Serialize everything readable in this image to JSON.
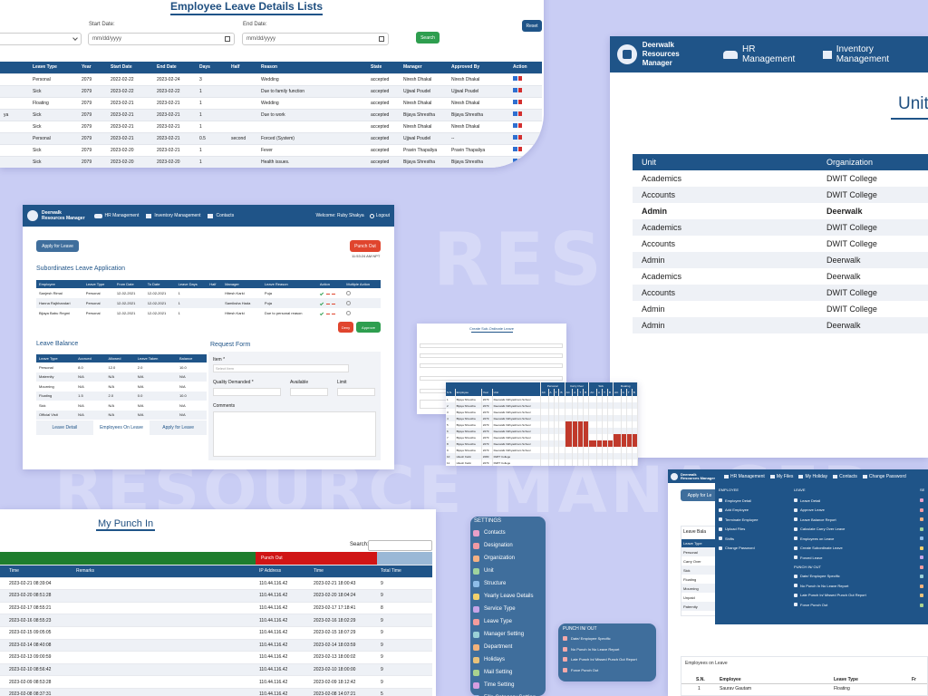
{
  "background_watermarks": [
    "RESOURCE MANAGER",
    "RESOURCE MANAGER"
  ],
  "leave_details": {
    "title": "Employee Leave Details Lists",
    "start_date_label": "Start Date:",
    "start_date_placeholder": "mm/dd/yyyy",
    "end_date_label": "End Date:",
    "end_date_placeholder": "mm/dd/yyyy",
    "search_label": "Search",
    "reset_label": "Reset",
    "columns": [
      "Leave Type",
      "Year",
      "Start Date",
      "End Date",
      "Days",
      "Half",
      "Reason",
      "State",
      "Manager",
      "Approved By",
      "Action"
    ],
    "rows": [
      [
        "Personal",
        "2079",
        "2022-02-22",
        "2023-02-24",
        "3",
        "",
        "Wedding",
        "accepted",
        "Niresh Dhakal",
        "Niresh Dhakal"
      ],
      [
        "Sick",
        "2079",
        "2023-02-22",
        "2023-02-22",
        "1",
        "",
        "Due to family function",
        "accepted",
        "Ujjwal Poudel",
        "Ujjwal Poudel"
      ],
      [
        "Floating",
        "2079",
        "2023-02-21",
        "2023-02-21",
        "1",
        "",
        "Wedding",
        "accepted",
        "Niresh Dhakal",
        "Niresh Dhakal"
      ],
      [
        "Sick",
        "2079",
        "2023-02-21",
        "2023-02-21",
        "1",
        "",
        "Due to work",
        "accepted",
        "Bijaya Shrestha",
        "Bijaya Shrestha"
      ],
      [
        "Sick",
        "2079",
        "2023-02-21",
        "2023-02-21",
        "1",
        "",
        "",
        "accepted",
        "Niresh Dhakal",
        "Niresh Dhakal"
      ],
      [
        "Personal",
        "2079",
        "2023-02-21",
        "2023-02-21",
        "0.5",
        "second",
        "Forced (System)",
        "accepted",
        "Ujjwal Poudel",
        "--"
      ],
      [
        "Sick",
        "2079",
        "2023-02-20",
        "2023-02-21",
        "1",
        "",
        "Fever",
        "accepted",
        "Pravin Thapaliya",
        "Pravin Thapaliya"
      ],
      [
        "Sick",
        "2079",
        "2023-02-20",
        "2023-02-20",
        "1",
        "",
        "Health issues.",
        "accepted",
        "Bijaya Shrestha",
        "Bijaya Shrestha"
      ]
    ],
    "partial_first_column": [
      "",
      "",
      "",
      "ya",
      "",
      "",
      "",
      ""
    ]
  },
  "unit_page": {
    "brand_line1": "Deerwalk",
    "brand_line2": "Resources Manager",
    "nav_hr": "HR Management",
    "nav_inventory": "Inventory Management",
    "title_partial": "Unit",
    "columns": [
      "Unit",
      "Organization"
    ],
    "rows": [
      [
        "Academics",
        "DWIT College"
      ],
      [
        "Accounts",
        "DWIT College"
      ],
      [
        "Admin",
        "Deerwalk"
      ],
      [
        "Academics",
        "DWIT College"
      ],
      [
        "Accounts",
        "DWIT College"
      ],
      [
        "Admin",
        "Deerwalk"
      ],
      [
        "Academics",
        "Deerwalk"
      ],
      [
        "Accounts",
        "DWIT College"
      ],
      [
        "Admin",
        "DWIT College"
      ],
      [
        "Admin",
        "Deerwalk"
      ]
    ],
    "bold_row_index": 2
  },
  "leave_apply": {
    "brand_line1": "Deerwalk",
    "brand_line2": "Resources Manager",
    "nav_hr": "HR Management",
    "nav_inventory": "Inventory Management",
    "nav_contacts": "Contacts",
    "welcome": "Welcome: Ruby Shakya",
    "logout": "Logout",
    "apply_btn": "Apply for Leave",
    "punch_out_btn": "Punch Out",
    "punch_time": "11:53:24 AM NPT",
    "subordinates_title": "Subordinates Leave Application",
    "sub_columns": [
      "Employee",
      "Leave Type",
      "From Date",
      "To Date",
      "Leave Days",
      "Half",
      "Manager",
      "Leave Reason",
      "Action",
      "Multiple Action"
    ],
    "sub_rows": [
      [
        "Sanjesh Rimal",
        "Personal",
        "12-02-2021",
        "12-02-2021",
        "1",
        "",
        "Hitesh Karki",
        "Puja"
      ],
      [
        "Hanna Rajbhandari",
        "Personal",
        "12-02-2021",
        "12-02-2021",
        "1",
        "",
        "Samiksha Hada",
        "Puja"
      ],
      [
        "Bijaya Babu Regmi",
        "Personal",
        "12-02-2021",
        "12-02-2021",
        "1",
        "",
        "Hitesh Karki",
        "Due to personal reason"
      ]
    ],
    "deny_btn": "Deny",
    "approve_btn": "Approve",
    "balance_title": "Leave Balance",
    "balance_columns": [
      "Leave Type",
      "Accrued",
      "Allowed",
      "Leave Taken",
      "Balance"
    ],
    "balance_rows": [
      [
        "Personal",
        "8.0",
        "12.0",
        "2.0",
        "10.0"
      ],
      [
        "Maternity",
        "N/A",
        "N/A",
        "N/A",
        "N/A"
      ],
      [
        "Mourning",
        "N/A",
        "N/A",
        "N/A",
        "N/A"
      ],
      [
        "Floating",
        "1.5",
        "2.0",
        "0.0",
        "10.0"
      ],
      [
        "Sick",
        "N/A",
        "N/A",
        "N/A",
        "N/A"
      ],
      [
        "Official Visit",
        "N/A",
        "N/A",
        "N/A",
        "N/A"
      ]
    ],
    "tabs": [
      "Leave Detail",
      "Employees On Leave",
      "Apply for Leave"
    ],
    "request_form_title": "Request Form",
    "item_label": "Item *",
    "item_placeholder": "Select Item",
    "qty_label": "Quality Demanded *",
    "available_label": "Available",
    "limit_label": "Limit",
    "comments_label": "Comments"
  },
  "create_sub_leave": {
    "title": "Create Sub-Ordinate Leave"
  },
  "yearly_report": {
    "group_headers": [
      "Personal",
      "Carry Over",
      "Sick",
      "Floating"
    ],
    "columns": [
      "S.N.",
      "Employee",
      "Year",
      "Unit"
    ],
    "sub_cols": [
      "AC",
      "A",
      "T",
      "B"
    ],
    "rows": [
      [
        "1",
        "Bijaya Shrestha",
        "2079",
        "Deerwalk Vidhyashram School"
      ],
      [
        "2",
        "Bijaya Shrestha",
        "2079",
        "Deerwalk Vidhyashram School"
      ],
      [
        "3",
        "Bijaya Shrestha",
        "2079",
        "Deerwalk Vidhyashram School"
      ],
      [
        "4",
        "Bijaya Shrestha",
        "2079",
        "Deerwalk Vidhyashram School"
      ],
      [
        "5",
        "Bijaya Shrestha",
        "2079",
        "Deerwalk Vidhyashram School"
      ],
      [
        "6",
        "Bijaya Shrestha",
        "2079",
        "Deerwalk Vidhyashram School"
      ],
      [
        "7",
        "Bijaya Shrestha",
        "2079",
        "Deerwalk Vidhyashram School"
      ],
      [
        "8",
        "Bijaya Shrestha",
        "2079",
        "Deerwalk Vidhyashram School"
      ],
      [
        "9",
        "Bijaya Shrestha",
        "2079",
        "Deerwalk Vidhyashram School"
      ],
      [
        "10",
        "Hitesh Karki",
        "2080",
        "DWIT College"
      ],
      [
        "11",
        "Hitesh Karki",
        "2079",
        "DWIT College"
      ]
    ]
  },
  "punch_in": {
    "title": "My Punch In",
    "search_label": "Search:",
    "punch_out_label": "Punch Out",
    "columns": [
      "Time",
      "Remarks",
      "IP Address",
      "Time",
      "Total Time"
    ],
    "rows": [
      [
        "2023-02-21 08:39:04",
        "",
        "110.44.116.42",
        "2023-02-21 18:00:43",
        "9"
      ],
      [
        "2023-02-20 08:51:28",
        "",
        "110.44.116.42",
        "2023-02-20 18:04:24",
        "9"
      ],
      [
        "2023-02-17 08:55:21",
        "",
        "110.44.116.42",
        "2023-02-17 17:18:41",
        "8"
      ],
      [
        "2023-02-16 08:55:23",
        "",
        "110.44.116.42",
        "2023-02-16 18:02:29",
        "9"
      ],
      [
        "2023-02-15 09:05:05",
        "",
        "110.44.116.42",
        "2023-02-15 18:07:29",
        "9"
      ],
      [
        "2023-02-14 08:40:08",
        "",
        "110.44.116.42",
        "2023-02-14 18:03:59",
        "9"
      ],
      [
        "2023-02-13 09:00:59",
        "",
        "110.44.116.42",
        "2023-02-13 18:00:02",
        "9"
      ],
      [
        "2023-02-10 08:56:42",
        "",
        "110.44.116.42",
        "2023-02-10 18:00:00",
        "9"
      ],
      [
        "2023-02-09 08:53:28",
        "",
        "110.44.116.42",
        "2023-02-09 18:12:42",
        "9"
      ],
      [
        "2023-02-08 08:37:31",
        "",
        "110.44.116.42",
        "2023-02-08 14:07:21",
        "5"
      ]
    ]
  },
  "settings_menu": {
    "title": "SETTINGS",
    "items": [
      "Contacts",
      "Designation",
      "Organization",
      "Unit",
      "Structure",
      "Yearly Leave Details",
      "Service Type",
      "Leave Type",
      "Manager Setting",
      "Department",
      "Holidays",
      "Mail Setting",
      "Time Setting",
      "Fills Category Setting"
    ]
  },
  "punch_menu": {
    "title": "PUNCH IN/ OUT",
    "items": [
      "Date/ Employee Specific",
      "No Punch In No Leave Report",
      "Late Punch In/ Missed Punch Out Report",
      "Force Punch Out"
    ]
  },
  "hr_menu_page": {
    "brand_line1": "Deerwalk",
    "brand_line2": "Resources Manager",
    "nav_items": [
      "HR Management",
      "My Files",
      "My Holiday",
      "Contacts",
      "Change Password"
    ],
    "apply_btn": "Apply for Le",
    "employee_header": "EMPLOYEE",
    "employee_items": [
      "Employee Detail",
      "Add Employee",
      "Terminate Employee",
      "Upload Files",
      "Shifts",
      "Change Password"
    ],
    "leave_header": "LEAVE",
    "leave_items": [
      "Leave Detail",
      "Approve Leave",
      "Leave Balance Report",
      "Calculate Carry Over Leave",
      "Employees on Leave",
      "Create Subordinate Leave",
      "Forced Leave"
    ],
    "punch_header": "PUNCH IN/ OUT",
    "punch_items": [
      "Date/ Employee Specific",
      "No Punch In No Leave Report",
      "Late Punch In/ Missed Punch Out Report",
      "Force Punch Out"
    ],
    "third_header": "SE",
    "balance_label": "Leave Bala",
    "balance_col": "Leave Type",
    "balance_types": [
      "Personal",
      "Carry Over",
      "Sick",
      "Floating",
      "Mourning",
      "Unpaid",
      "Paternity"
    ],
    "on_leave_title": "Employees on Leave",
    "on_leave_columns": [
      "S.N.",
      "Employee",
      "Leave Type",
      "Fr"
    ],
    "on_leave_rows": [
      [
        "1",
        "Saurav Gautam",
        "Floating",
        ""
      ]
    ]
  },
  "colors": {
    "primary": "#1f5488",
    "background": "#c9cdf4",
    "success": "#2e9e4f",
    "danger": "#e0452e",
    "sidebar": "#3f6e9c"
  }
}
